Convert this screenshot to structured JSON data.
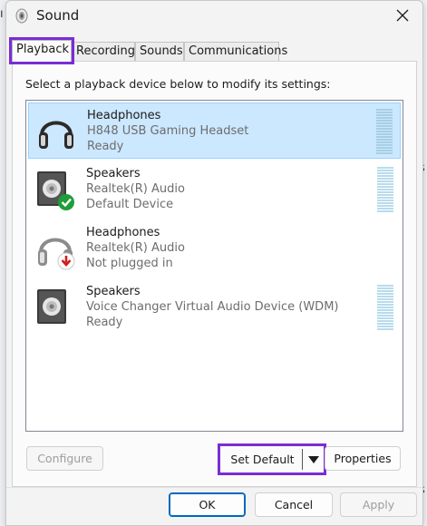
{
  "window": {
    "title": "Sound",
    "icon": "speaker-icon",
    "close_icon": "close-icon"
  },
  "tabs": [
    {
      "label": "Playback",
      "active": true
    },
    {
      "label": "Recording",
      "active": false
    },
    {
      "label": "Sounds",
      "active": false
    },
    {
      "label": "Communications",
      "active": false
    }
  ],
  "instruction": "Select a playback device below to modify its settings:",
  "devices": [
    {
      "name": "Headphones",
      "driver": "H848 USB Gaming Headset",
      "status": "Ready",
      "icon": "headphones-icon",
      "selected": true,
      "badge": null,
      "has_level_meter": true
    },
    {
      "name": "Speakers",
      "driver": "Realtek(R) Audio",
      "status": "Default Device",
      "icon": "speaker-icon",
      "selected": false,
      "badge": "green-check-badge",
      "has_level_meter": true
    },
    {
      "name": "Headphones",
      "driver": "Realtek(R) Audio",
      "status": "Not plugged in",
      "icon": "headphones-icon",
      "selected": false,
      "badge": "red-down-arrow-badge",
      "has_level_meter": false
    },
    {
      "name": "Speakers",
      "driver": "Voice Changer Virtual Audio Device (WDM)",
      "status": "Ready",
      "icon": "speaker-icon",
      "selected": false,
      "badge": null,
      "has_level_meter": true
    }
  ],
  "buttons": {
    "configure": "Configure",
    "set_default": "Set Default",
    "properties": "Properties",
    "ok": "OK",
    "cancel": "Cancel",
    "apply": "Apply"
  },
  "highlight_color": "#7b2cd4",
  "selection_color": "#cce8ff"
}
